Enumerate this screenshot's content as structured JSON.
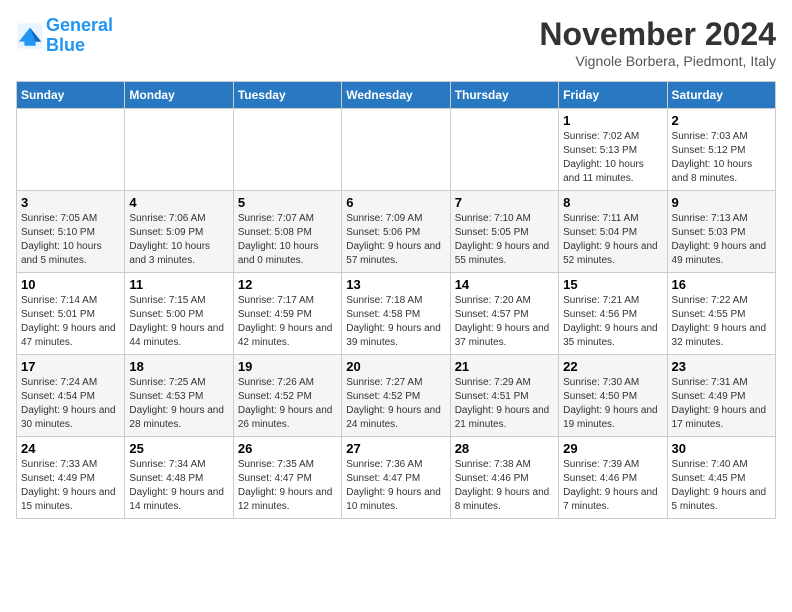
{
  "header": {
    "logo_line1": "General",
    "logo_line2": "Blue",
    "month": "November 2024",
    "location": "Vignole Borbera, Piedmont, Italy"
  },
  "weekdays": [
    "Sunday",
    "Monday",
    "Tuesday",
    "Wednesday",
    "Thursday",
    "Friday",
    "Saturday"
  ],
  "weeks": [
    [
      {
        "day": "",
        "info": ""
      },
      {
        "day": "",
        "info": ""
      },
      {
        "day": "",
        "info": ""
      },
      {
        "day": "",
        "info": ""
      },
      {
        "day": "",
        "info": ""
      },
      {
        "day": "1",
        "info": "Sunrise: 7:02 AM\nSunset: 5:13 PM\nDaylight: 10 hours and 11 minutes."
      },
      {
        "day": "2",
        "info": "Sunrise: 7:03 AM\nSunset: 5:12 PM\nDaylight: 10 hours and 8 minutes."
      }
    ],
    [
      {
        "day": "3",
        "info": "Sunrise: 7:05 AM\nSunset: 5:10 PM\nDaylight: 10 hours and 5 minutes."
      },
      {
        "day": "4",
        "info": "Sunrise: 7:06 AM\nSunset: 5:09 PM\nDaylight: 10 hours and 3 minutes."
      },
      {
        "day": "5",
        "info": "Sunrise: 7:07 AM\nSunset: 5:08 PM\nDaylight: 10 hours and 0 minutes."
      },
      {
        "day": "6",
        "info": "Sunrise: 7:09 AM\nSunset: 5:06 PM\nDaylight: 9 hours and 57 minutes."
      },
      {
        "day": "7",
        "info": "Sunrise: 7:10 AM\nSunset: 5:05 PM\nDaylight: 9 hours and 55 minutes."
      },
      {
        "day": "8",
        "info": "Sunrise: 7:11 AM\nSunset: 5:04 PM\nDaylight: 9 hours and 52 minutes."
      },
      {
        "day": "9",
        "info": "Sunrise: 7:13 AM\nSunset: 5:03 PM\nDaylight: 9 hours and 49 minutes."
      }
    ],
    [
      {
        "day": "10",
        "info": "Sunrise: 7:14 AM\nSunset: 5:01 PM\nDaylight: 9 hours and 47 minutes."
      },
      {
        "day": "11",
        "info": "Sunrise: 7:15 AM\nSunset: 5:00 PM\nDaylight: 9 hours and 44 minutes."
      },
      {
        "day": "12",
        "info": "Sunrise: 7:17 AM\nSunset: 4:59 PM\nDaylight: 9 hours and 42 minutes."
      },
      {
        "day": "13",
        "info": "Sunrise: 7:18 AM\nSunset: 4:58 PM\nDaylight: 9 hours and 39 minutes."
      },
      {
        "day": "14",
        "info": "Sunrise: 7:20 AM\nSunset: 4:57 PM\nDaylight: 9 hours and 37 minutes."
      },
      {
        "day": "15",
        "info": "Sunrise: 7:21 AM\nSunset: 4:56 PM\nDaylight: 9 hours and 35 minutes."
      },
      {
        "day": "16",
        "info": "Sunrise: 7:22 AM\nSunset: 4:55 PM\nDaylight: 9 hours and 32 minutes."
      }
    ],
    [
      {
        "day": "17",
        "info": "Sunrise: 7:24 AM\nSunset: 4:54 PM\nDaylight: 9 hours and 30 minutes."
      },
      {
        "day": "18",
        "info": "Sunrise: 7:25 AM\nSunset: 4:53 PM\nDaylight: 9 hours and 28 minutes."
      },
      {
        "day": "19",
        "info": "Sunrise: 7:26 AM\nSunset: 4:52 PM\nDaylight: 9 hours and 26 minutes."
      },
      {
        "day": "20",
        "info": "Sunrise: 7:27 AM\nSunset: 4:52 PM\nDaylight: 9 hours and 24 minutes."
      },
      {
        "day": "21",
        "info": "Sunrise: 7:29 AM\nSunset: 4:51 PM\nDaylight: 9 hours and 21 minutes."
      },
      {
        "day": "22",
        "info": "Sunrise: 7:30 AM\nSunset: 4:50 PM\nDaylight: 9 hours and 19 minutes."
      },
      {
        "day": "23",
        "info": "Sunrise: 7:31 AM\nSunset: 4:49 PM\nDaylight: 9 hours and 17 minutes."
      }
    ],
    [
      {
        "day": "24",
        "info": "Sunrise: 7:33 AM\nSunset: 4:49 PM\nDaylight: 9 hours and 15 minutes."
      },
      {
        "day": "25",
        "info": "Sunrise: 7:34 AM\nSunset: 4:48 PM\nDaylight: 9 hours and 14 minutes."
      },
      {
        "day": "26",
        "info": "Sunrise: 7:35 AM\nSunset: 4:47 PM\nDaylight: 9 hours and 12 minutes."
      },
      {
        "day": "27",
        "info": "Sunrise: 7:36 AM\nSunset: 4:47 PM\nDaylight: 9 hours and 10 minutes."
      },
      {
        "day": "28",
        "info": "Sunrise: 7:38 AM\nSunset: 4:46 PM\nDaylight: 9 hours and 8 minutes."
      },
      {
        "day": "29",
        "info": "Sunrise: 7:39 AM\nSunset: 4:46 PM\nDaylight: 9 hours and 7 minutes."
      },
      {
        "day": "30",
        "info": "Sunrise: 7:40 AM\nSunset: 4:45 PM\nDaylight: 9 hours and 5 minutes."
      }
    ]
  ]
}
